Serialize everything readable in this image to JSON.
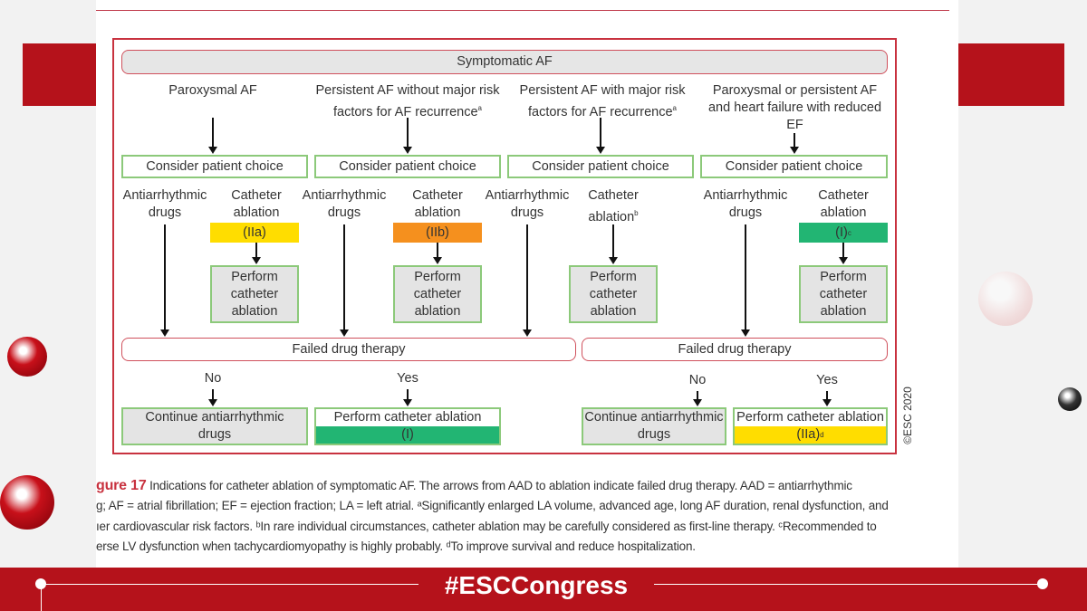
{
  "diagram": {
    "root": "Symptomatic AF",
    "columns": [
      {
        "heading": "Paroxysmal AF",
        "choice": "Consider patient choice",
        "aad": "Antiarrhythmic drugs",
        "ca": "Catheter ablation",
        "class": "(IIa)",
        "class_color": "#ffdd00",
        "perform": "Perform catheter ablation"
      },
      {
        "heading": "Persistent AF without major risk factors for AF recurrence",
        "heading_sup": "a",
        "choice": "Consider patient choice",
        "aad": "Antiarrhythmic drugs",
        "ca": "Catheter ablation",
        "class": "(IIb)",
        "class_color": "#f5901e",
        "perform": "Perform catheter ablation"
      },
      {
        "heading": "Persistent AF with major risk factors for AF recurrence",
        "heading_sup": "a",
        "choice": "Consider patient choice",
        "aad": "Antiarrhythmic drugs",
        "ca": "Catheter ablation",
        "ca_sup": "b",
        "perform": "Perform catheter ablation"
      },
      {
        "heading": "Paroxysmal or persistent AF and heart failure with reduced EF",
        "choice": "Consider patient choice",
        "aad": "Antiarrhythmic drugs",
        "ca": "Catheter ablation",
        "class": "(I)",
        "class_sup": "c",
        "class_color": "#22b573",
        "perform": "Perform catheter ablation"
      }
    ],
    "failed": [
      "Failed drug therapy",
      "Failed drug therapy"
    ],
    "no": "No",
    "yes": "Yes",
    "continue": "Continue antiarrhythmic drugs",
    "perform_bottom": "Perform catheter ablation",
    "bottom_left_class": "(I)",
    "bottom_left_color": "#22b573",
    "bottom_right_class": "(IIa)",
    "bottom_right_sup": "d",
    "bottom_right_color": "#ffdd00",
    "copyright": "©ESC 2020"
  },
  "caption": {
    "label": "gure 17",
    "lines": [
      "Indications for catheter ablation of symptomatic AF. The arrows from AAD to ablation indicate failed drug therapy. AAD = antiarrhythmic",
      "g; AF = atrial fibrillation; EF = ejection fraction; LA = left atrial. ᵃSignificantly enlarged LA volume, advanced age, long AF duration, renal dysfunction, and",
      "ıer cardiovascular risk factors. ᵇIn rare individual circumstances, catheter ablation may be carefully considered as first-line therapy. ᶜRecommended to",
      "erse LV dysfunction when tachycardiomyopathy is highly probably. ᵈTo improve survival and reduce hospitalization."
    ]
  },
  "footer": {
    "hashtag": "#ESCCongress"
  },
  "colors": {
    "brand_red": "#b5121b",
    "box_green_border": "#8cc97a"
  }
}
